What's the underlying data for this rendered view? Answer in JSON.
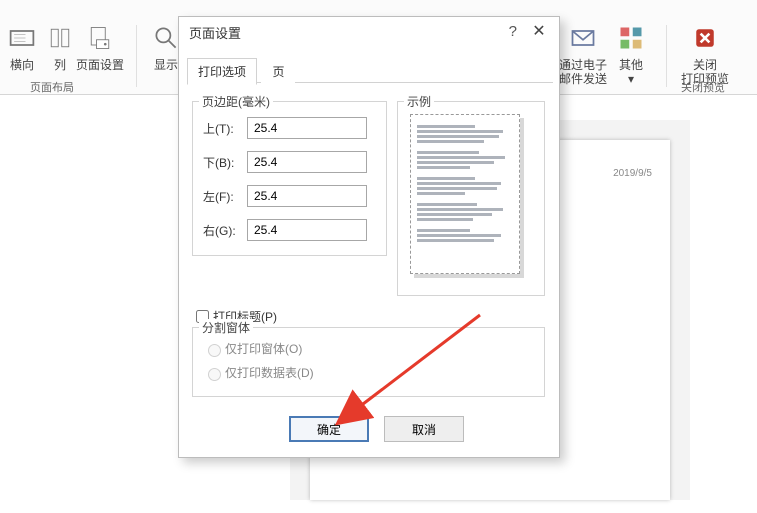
{
  "ribbon": {
    "items": [
      {
        "label": "横向"
      },
      {
        "label": "列"
      },
      {
        "label": "页面设置"
      },
      {
        "label": "显示"
      }
    ],
    "group_left": "页面布局",
    "right_items": [
      {
        "label_l1": "通过电子",
        "label_l2": "邮件发送"
      },
      {
        "label_l1": "其他",
        "label_l2": ""
      },
      {
        "label_l1": "关闭",
        "label_l2": "打印预览"
      }
    ],
    "group_right": "关闭预览"
  },
  "doc": {
    "date": "2019/9/5"
  },
  "dialog": {
    "title": "页面设置",
    "help": "?",
    "close": "✕",
    "tabs": {
      "t0": "打印选项",
      "t1": "页"
    },
    "margins": {
      "legend": "页边距(毫米)",
      "rows": {
        "top": {
          "label": "上(T):",
          "value": "25.4"
        },
        "bottom": {
          "label": "下(B):",
          "value": "25.4"
        },
        "left": {
          "label": "左(F):",
          "value": "25.4"
        },
        "right": {
          "label": "右(G):",
          "value": "25.4"
        }
      }
    },
    "example": {
      "legend": "示例"
    },
    "print_title": "打印标题(P)",
    "split": {
      "legend": "分割窗体",
      "form_only": "仅打印窗体(O)",
      "table_only": "仅打印数据表(D)"
    },
    "ok": "确定",
    "cancel": "取消"
  }
}
